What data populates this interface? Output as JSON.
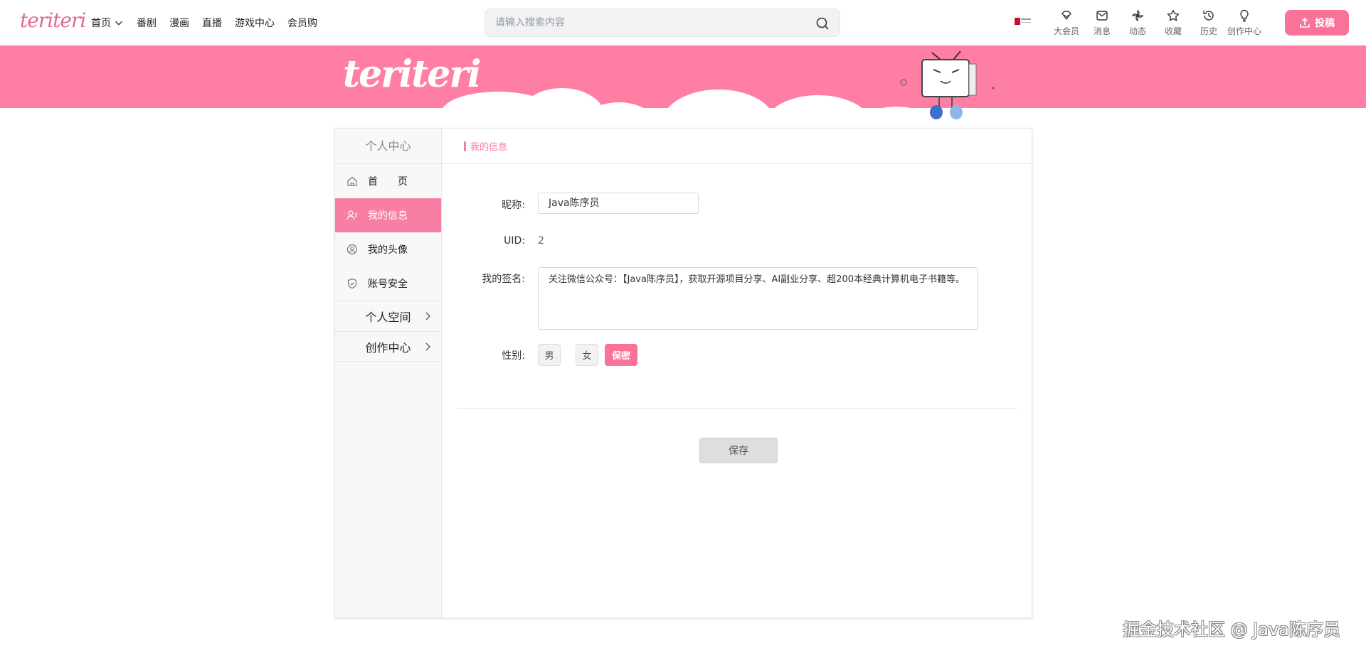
{
  "header": {
    "logo": "teriteri",
    "nav": [
      {
        "label": "首页",
        "has_dropdown": true
      },
      {
        "label": "番剧"
      },
      {
        "label": "漫画"
      },
      {
        "label": "直播"
      },
      {
        "label": "游戏中心"
      },
      {
        "label": "会员购"
      }
    ],
    "search": {
      "placeholder": "请输入搜索内容",
      "value": ""
    },
    "right_icons": [
      {
        "label": "大会员",
        "icon": "diamond-icon"
      },
      {
        "label": "消息",
        "icon": "mail-icon"
      },
      {
        "label": "动态",
        "icon": "pinwheel-icon"
      },
      {
        "label": "收藏",
        "icon": "star-icon"
      },
      {
        "label": "历史",
        "icon": "history-icon"
      },
      {
        "label": "创作中心",
        "icon": "bulb-icon"
      }
    ],
    "upload_label": "投稿",
    "accent_color": "#fb7299"
  },
  "banner": {
    "logo": "teriteri",
    "color": "#ff7ea4"
  },
  "sidebar": {
    "title": "个人中心",
    "items": [
      {
        "label": "首　　页",
        "icon": "home-icon",
        "active": false
      },
      {
        "label": "我的信息",
        "icon": "user-info-icon",
        "active": true
      },
      {
        "label": "我的头像",
        "icon": "avatar-icon",
        "active": false
      },
      {
        "label": "账号安全",
        "icon": "shield-icon",
        "active": false
      }
    ],
    "groups": [
      {
        "label": "个人空间"
      },
      {
        "label": "创作中心"
      }
    ]
  },
  "main": {
    "section_title": "我的信息",
    "nickname_label": "昵称:",
    "nickname_value": "Java陈序员",
    "uid_label": "UID:",
    "uid_value": "2",
    "signature_label": "我的签名:",
    "signature_value": "关注微信公众号：【Java陈序员】，获取开源项目分享、AI副业分享、超200本经典计算机电子书籍等。",
    "gender_label": "性别:",
    "gender_options": [
      "男",
      "女",
      "保密"
    ],
    "gender_selected": "保密",
    "save_label": "保存"
  },
  "watermark": "掘金技术社区 @ Java陈序员"
}
